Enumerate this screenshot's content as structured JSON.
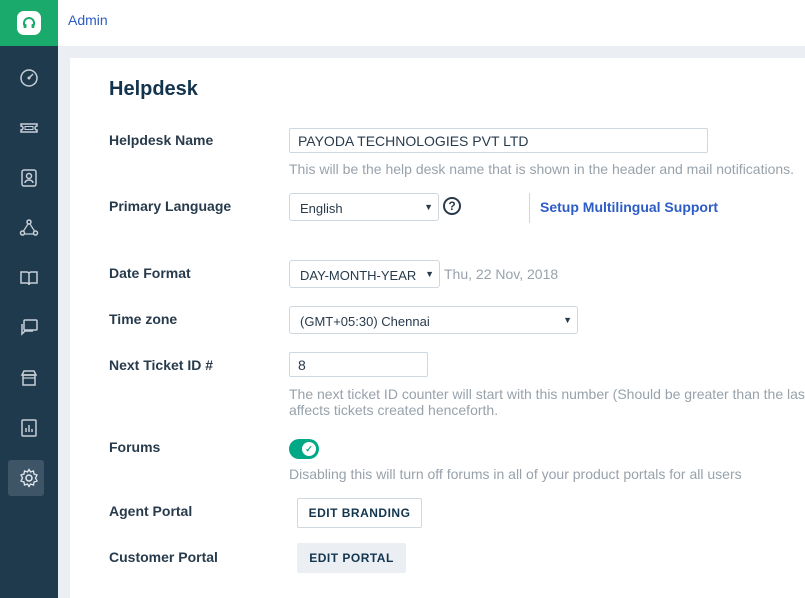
{
  "header": {
    "breadcrumb": "Admin"
  },
  "sidebar": {
    "items": [
      {
        "icon": "dashboard-icon"
      },
      {
        "icon": "ticket-icon"
      },
      {
        "icon": "contact-icon"
      },
      {
        "icon": "social-icon"
      },
      {
        "icon": "book-icon"
      },
      {
        "icon": "chat-icon"
      },
      {
        "icon": "store-icon"
      },
      {
        "icon": "report-icon"
      },
      {
        "icon": "gear-icon",
        "active": true
      }
    ]
  },
  "main": {
    "title": "Helpdesk",
    "helpdesk_name": {
      "label": "Helpdesk Name",
      "value": "PAYODA TECHNOLOGIES PVT LTD",
      "hint": "This will be the help desk name that is shown in the header and mail notifications."
    },
    "primary_language": {
      "label": "Primary Language",
      "value": "English",
      "help": "?",
      "link": "Setup Multilingual Support"
    },
    "date_format": {
      "label": "Date Format",
      "value": "DAY-MONTH-YEAR",
      "example": "Thu, 22 Nov, 2018"
    },
    "time_zone": {
      "label": "Time zone",
      "value": "(GMT+05:30) Chennai"
    },
    "next_ticket": {
      "label": "Next Ticket ID #",
      "value": "8",
      "hint_line1": "The next ticket ID counter will start with this number (Should be greater than the las",
      "hint_line2": "affects tickets created henceforth."
    },
    "forums": {
      "label": "Forums",
      "enabled": true,
      "hint": "Disabling this will turn off forums in all of your product portals for all users"
    },
    "agent_portal": {
      "label": "Agent Portal",
      "button": "EDIT BRANDING"
    },
    "customer_portal": {
      "label": "Customer Portal",
      "button": "EDIT PORTAL"
    }
  },
  "colors": {
    "brand": "#1aab6c",
    "sidebar": "#1f3a4d",
    "link": "#2c5cc5",
    "toggle_on": "#00a886"
  }
}
